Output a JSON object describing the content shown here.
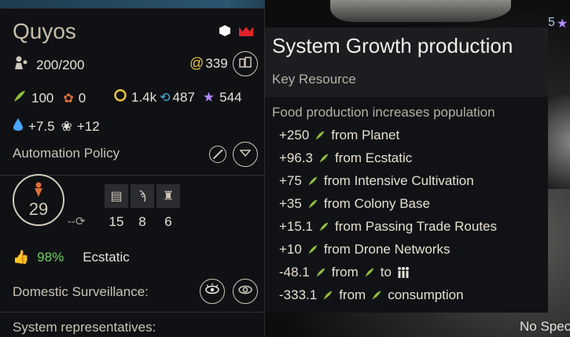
{
  "planet": {
    "name": "Quyos",
    "population": "200/200",
    "influence": "339",
    "food": "100",
    "industry": "0",
    "dust": "1.4k",
    "science": "487",
    "influence2": "544",
    "water_bonus": "+7.5",
    "lotus_bonus": "+12",
    "automation_label": "Automation Policy",
    "level": "29",
    "policies": [
      {
        "icon": "building-icon",
        "value": "15"
      },
      {
        "icon": "glyph-icon",
        "value": "8"
      },
      {
        "icon": "tower-icon",
        "value": "6"
      }
    ],
    "approval_pct": "98%",
    "approval_status": "Ecstatic",
    "surveillance_label": "Domestic Surveillance:",
    "representatives_label": "System representatives:"
  },
  "tooltip": {
    "title": "System Growth production",
    "subtitle": "Key Resource",
    "description": "Food production increases population",
    "lines": [
      {
        "value": "+250",
        "text": "from Planet"
      },
      {
        "value": "+96.3",
        "text": "from Ecstatic"
      },
      {
        "value": "+75",
        "text": "from Intensive Cultivation"
      },
      {
        "value": "+35",
        "text": "from Colony Base"
      },
      {
        "value": "+15.1",
        "text": "from Passing Trade Routes"
      },
      {
        "value": "+10",
        "text": "from Drone Networks"
      },
      {
        "value": "-48.1",
        "text": "from",
        "suffix": "to"
      },
      {
        "value": "-333.1",
        "text": "from",
        "suffix": "consumption"
      }
    ]
  },
  "background": {
    "no_spec_text": "No Spec"
  },
  "colors": {
    "food_green": "#8fbf3a",
    "approval_green": "#6fd25c",
    "crown_red": "#e2232b",
    "star_purple": "#b38bff",
    "water_blue": "#4aa6ff"
  }
}
